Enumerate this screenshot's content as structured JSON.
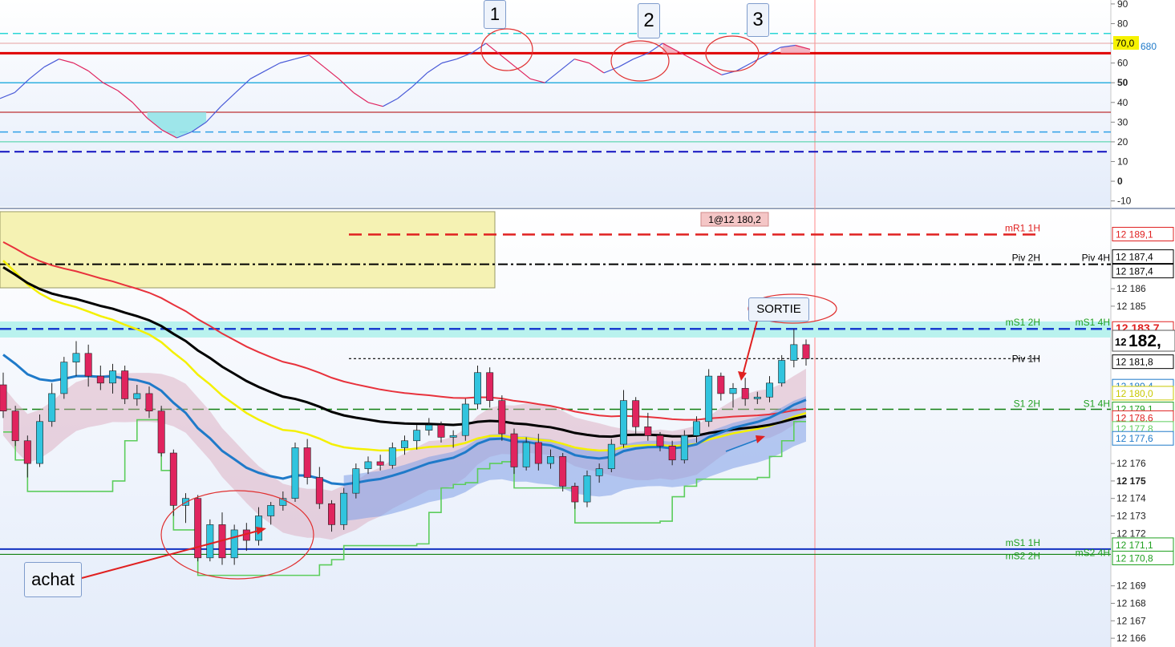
{
  "colors": {
    "bull_candle": "#31c4de",
    "bear_candle": "#e0245e",
    "ma_black": "#000000",
    "ma_red": "#e8323c",
    "ma_yellow": "#f4f000",
    "ma_blue": "#1f7ac9",
    "trail_green": "#5ccd5c",
    "rsi_line": "#4a5bd8",
    "panel_bg": "#e9effb"
  },
  "rsi_panel": {
    "y_ticks": [
      "90",
      "80",
      "70",
      "60",
      "50",
      "40",
      "30",
      "20",
      "10",
      "0",
      "-10"
    ],
    "level_badge": "70,0",
    "level_badge_side": "680",
    "markers": [
      "1",
      "2",
      "3"
    ]
  },
  "price_panel": {
    "y_ticks": [
      "12 186",
      "12 185",
      "12 176",
      "12 175",
      "12 174",
      "12 173",
      "12 172",
      "12 169",
      "12 168",
      "12 167",
      "12 166"
    ],
    "level_labels": [
      {
        "text": "mR1 1H",
        "color": "#e02020"
      },
      {
        "text": "Piv 2H",
        "color": "#000000"
      },
      {
        "text": "Piv 4H",
        "color": "#000000"
      },
      {
        "text": "mS1 2H",
        "color": "#20a020"
      },
      {
        "text": "mS1 4H",
        "color": "#20a020"
      },
      {
        "text": "Piv 1H",
        "color": "#000000"
      },
      {
        "text": "S1 2H",
        "color": "#20a020"
      },
      {
        "text": "S1 4H",
        "color": "#20a020"
      },
      {
        "text": "mS1 1H",
        "color": "#20a020"
      },
      {
        "text": "mS2 2H",
        "color": "#20a020"
      },
      {
        "text": "mS2 4H",
        "color": "#20a020"
      }
    ],
    "price_tags": [
      {
        "text": "12 189,1",
        "color": "#e02020"
      },
      {
        "text": "12 187,4",
        "color": "#000000"
      },
      {
        "text": "12 187,4",
        "color": "#000000"
      },
      {
        "text": "12 183,7",
        "color": "#e02020"
      },
      {
        "text": "12 181,8",
        "color": "#000000"
      },
      {
        "text": "12 180,4",
        "color": "#1f7ac9"
      },
      {
        "text": "12 180,0",
        "color": "#c8c800"
      },
      {
        "text": "12 179,1",
        "color": "#20a020"
      },
      {
        "text": "12 178,6",
        "color": "#e02020"
      },
      {
        "text": "12 177,8",
        "color": "#5ccd5c"
      },
      {
        "text": "12 177,6",
        "color": "#1f7ac9"
      },
      {
        "text": "12 171,1",
        "color": "#20a020"
      },
      {
        "text": "12 170,8",
        "color": "#20a020"
      }
    ],
    "current_price_prefix": "12",
    "current_price_big": "182,",
    "order_label": "1@12 180,2",
    "buy_note": "achat",
    "exit_note": "SORTIE"
  },
  "chart_data": {
    "type": "line",
    "title": "",
    "candles": [
      [
        12180.5,
        12181.2,
        12178.6,
        12179.0
      ],
      [
        12179.0,
        12179.3,
        12177.0,
        12177.3
      ],
      [
        12177.3,
        12177.6,
        12175.2,
        12176.0
      ],
      [
        12176.0,
        12178.8,
        12175.8,
        12178.4
      ],
      [
        12178.4,
        12180.6,
        12178.1,
        12180.0
      ],
      [
        12180.0,
        12182.1,
        12179.7,
        12181.8
      ],
      [
        12181.8,
        12183.0,
        12181.0,
        12182.3
      ],
      [
        12182.3,
        12182.8,
        12180.4,
        12181.0
      ],
      [
        12181.0,
        12181.6,
        12180.2,
        12180.6
      ],
      [
        12180.6,
        12181.7,
        12180.0,
        12181.3
      ],
      [
        12181.3,
        12181.6,
        12179.4,
        12179.7
      ],
      [
        12179.7,
        12180.5,
        12179.3,
        12180.0
      ],
      [
        12180.0,
        12180.4,
        12178.6,
        12179.0
      ],
      [
        12179.0,
        12179.3,
        12176.4,
        12176.6
      ],
      [
        12176.6,
        12176.8,
        12173.0,
        12173.6
      ],
      [
        12173.6,
        12174.3,
        12172.6,
        12174.0
      ],
      [
        12174.0,
        12174.2,
        12170.4,
        12170.6
      ],
      [
        12170.6,
        12172.8,
        12170.4,
        12172.5
      ],
      [
        12172.5,
        12173.2,
        12170.2,
        12170.6
      ],
      [
        12170.6,
        12172.5,
        12170.2,
        12172.2
      ],
      [
        12172.2,
        12172.6,
        12171.0,
        12171.6
      ],
      [
        12171.6,
        12173.5,
        12171.3,
        12173.0
      ],
      [
        12173.0,
        12173.8,
        12172.5,
        12173.6
      ],
      [
        12173.6,
        12174.4,
        12173.3,
        12174.0
      ],
      [
        12174.0,
        12177.2,
        12173.8,
        12176.9
      ],
      [
        12176.9,
        12177.4,
        12174.8,
        12175.2
      ],
      [
        12175.2,
        12175.8,
        12173.4,
        12173.7
      ],
      [
        12173.7,
        12173.9,
        12172.1,
        12172.5
      ],
      [
        12172.5,
        12174.6,
        12172.2,
        12174.3
      ],
      [
        12174.3,
        12176.0,
        12174.0,
        12175.7
      ],
      [
        12175.7,
        12176.4,
        12175.4,
        12176.1
      ],
      [
        12176.1,
        12176.5,
        12175.6,
        12175.9
      ],
      [
        12175.9,
        12177.2,
        12175.7,
        12176.9
      ],
      [
        12176.9,
        12177.6,
        12176.5,
        12177.3
      ],
      [
        12177.3,
        12178.2,
        12176.8,
        12177.9
      ],
      [
        12177.9,
        12178.6,
        12177.6,
        12178.2
      ],
      [
        12178.2,
        12178.4,
        12177.2,
        12177.5
      ],
      [
        12177.5,
        12177.9,
        12176.9,
        12177.6
      ],
      [
        12177.6,
        12179.7,
        12177.3,
        12179.4
      ],
      [
        12179.4,
        12181.6,
        12179.1,
        12181.2
      ],
      [
        12181.2,
        12181.5,
        12179.2,
        12179.6
      ],
      [
        12179.6,
        12179.9,
        12177.3,
        12177.7
      ],
      [
        12177.7,
        12178.0,
        12175.4,
        12175.8
      ],
      [
        12175.8,
        12177.5,
        12175.6,
        12177.2
      ],
      [
        12177.2,
        12177.7,
        12175.6,
        12176.0
      ],
      [
        12176.0,
        12176.8,
        12175.7,
        12176.4
      ],
      [
        12176.4,
        12176.6,
        12174.4,
        12174.7
      ],
      [
        12174.7,
        12174.9,
        12173.4,
        12173.8
      ],
      [
        12173.8,
        12175.6,
        12173.5,
        12175.3
      ],
      [
        12175.3,
        12176.0,
        12174.9,
        12175.7
      ],
      [
        12175.7,
        12177.4,
        12175.5,
        12177.1
      ],
      [
        12177.1,
        12180.2,
        12176.9,
        12179.6
      ],
      [
        12179.6,
        12179.8,
        12177.7,
        12178.1
      ],
      [
        12178.1,
        12178.9,
        12177.3,
        12177.6
      ],
      [
        12177.6,
        12177.8,
        12176.7,
        12177.0
      ],
      [
        12177.0,
        12177.3,
        12175.9,
        12176.2
      ],
      [
        12176.2,
        12177.9,
        12176.0,
        12177.6
      ],
      [
        12177.6,
        12178.7,
        12177.2,
        12178.4
      ],
      [
        12178.4,
        12181.4,
        12178.1,
        12181.0
      ],
      [
        12181.0,
        12181.2,
        12179.6,
        12180.0
      ],
      [
        12180.0,
        12180.6,
        12179.2,
        12180.3
      ],
      [
        12180.3,
        12180.9,
        12179.3,
        12179.7
      ],
      [
        12179.7,
        12180.1,
        12179.4,
        12179.8
      ],
      [
        12179.8,
        12181.0,
        12179.5,
        12180.6
      ],
      [
        12180.6,
        12182.2,
        12180.4,
        12181.9
      ],
      [
        12181.9,
        12183.7,
        12181.5,
        12182.8
      ],
      [
        12182.8,
        12183.1,
        12181.6,
        12182.0
      ]
    ],
    "series": [
      {
        "name": "RSI",
        "values": [
          42,
          45,
          52,
          58,
          62,
          60,
          56,
          50,
          46,
          40,
          32,
          26,
          22,
          25,
          30,
          38,
          45,
          52,
          56,
          60,
          62,
          64,
          58,
          52,
          45,
          40,
          38,
          42,
          48,
          55,
          60,
          62,
          65,
          70,
          64,
          58,
          52,
          50,
          56,
          62,
          60,
          55,
          58,
          62,
          65,
          70,
          66,
          62,
          58,
          54,
          56,
          60,
          64,
          68,
          69,
          67
        ]
      }
    ],
    "x_range_note": "",
    "ylim_price": [
      12165.5,
      12190.5
    ],
    "ylim_rsi": [
      -13,
      92
    ],
    "horizontal_levels_price": [
      12189.1,
      12187.4,
      12183.7,
      12182.0,
      12179.1,
      12171.1,
      12170.8
    ],
    "horizontal_levels_rsi": [
      75,
      70,
      65,
      50,
      35,
      25,
      20,
      15
    ],
    "grid": false,
    "legend": "none"
  }
}
